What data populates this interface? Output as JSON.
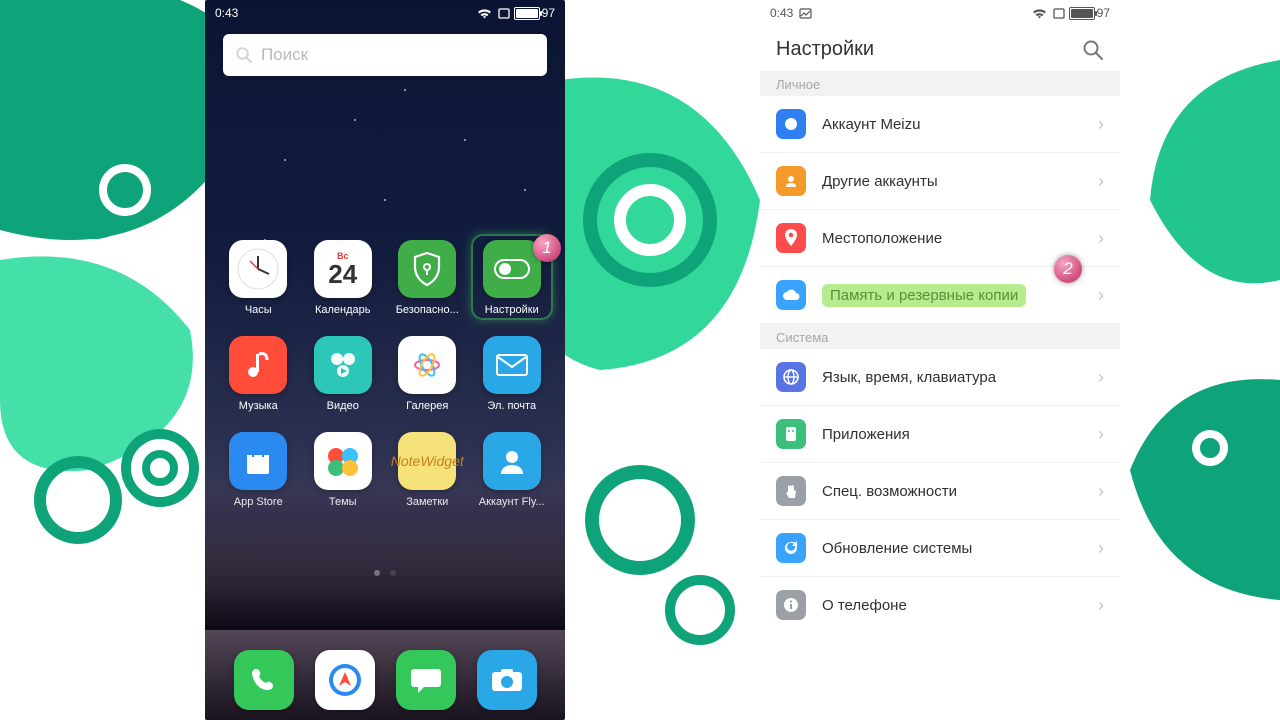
{
  "status": {
    "time": "0:43",
    "battery": "97"
  },
  "home": {
    "search_placeholder": "Поиск",
    "calendar": {
      "dow": "Вс",
      "day": "24"
    },
    "apps": {
      "clock": "Часы",
      "calendar": "Календарь",
      "security": "Безопасно...",
      "settings": "Настройки",
      "music": "Музыка",
      "video": "Видео",
      "gallery": "Галерея",
      "email": "Эл. почта",
      "appstore": "App Store",
      "themes": "Темы",
      "notes": "Заметки",
      "notes_icon_top": "Note",
      "notes_icon_bottom": "Widget",
      "account": "Аккаунт Fly..."
    },
    "step1": "1"
  },
  "settings": {
    "title": "Настройки",
    "section_personal": "Личное",
    "section_system": "Система",
    "items": {
      "meizu": "Аккаунт Meizu",
      "other_accounts": "Другие аккаунты",
      "location": "Местоположение",
      "storage_backup": "Память и резервные копии",
      "lang_time_keyb": "Язык, время, клавиатура",
      "apps": "Приложения",
      "accessibility": "Спец. возможности",
      "update": "Обновление системы",
      "about": "О телефоне"
    },
    "step2": "2"
  },
  "colors": {
    "meizu": "#2f7ff1",
    "other": "#f59a2a",
    "loc": "#ff4b4b",
    "storage": "#3aa3ff",
    "lang": "#5a74e6",
    "apps": "#3bbf7a",
    "access": "#9aa0a6",
    "update": "#3aa3ff",
    "about": "#9aa0a6"
  }
}
